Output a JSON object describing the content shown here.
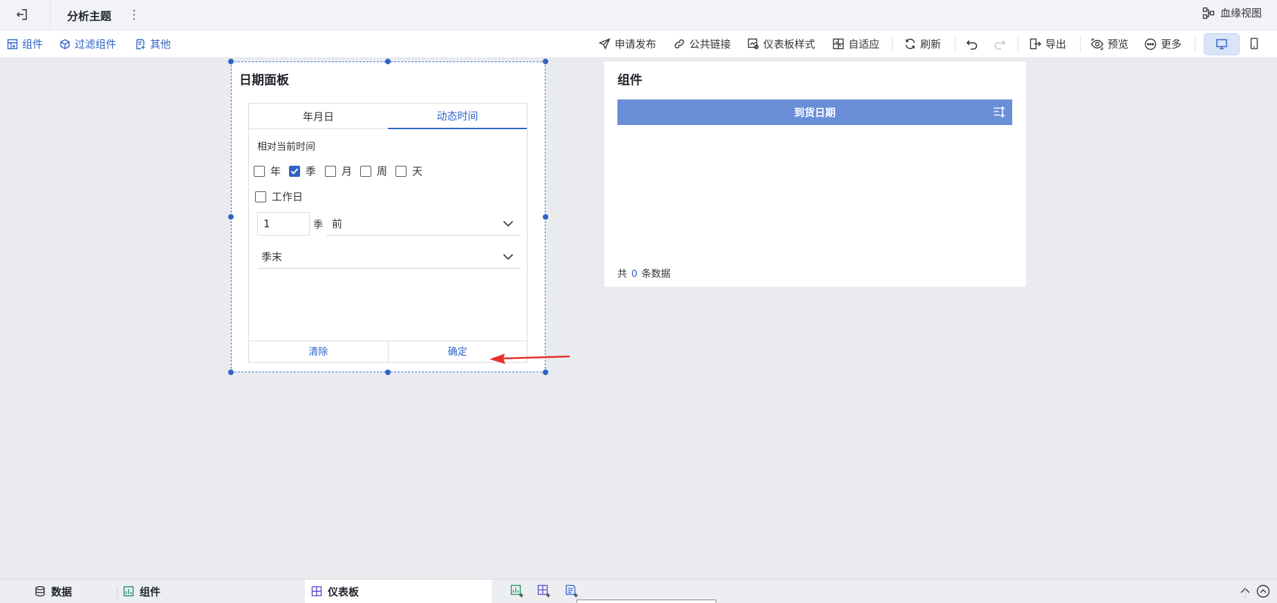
{
  "header": {
    "title": "分析主题",
    "lineage_label": "血缘视图"
  },
  "toolbar": {
    "left": [
      {
        "label": "组件",
        "icon": "add-component-icon"
      },
      {
        "label": "过滤组件",
        "icon": "filter-component-icon"
      },
      {
        "label": "其他",
        "icon": "other-icon"
      }
    ],
    "right": {
      "publish": "申请发布",
      "public_link": "公共链接",
      "dashboard_style": "仪表板样式",
      "adaptive": "自适应",
      "refresh": "刷新",
      "export": "导出",
      "preview": "预览",
      "more": "更多"
    }
  },
  "date_panel": {
    "title": "日期面板",
    "tabs": [
      "年月日",
      "动态时间"
    ],
    "active_tab": "动态时间",
    "relative_label": "相对当前时间",
    "units": [
      {
        "label": "年",
        "checked": false
      },
      {
        "label": "季",
        "checked": true
      },
      {
        "label": "月",
        "checked": false
      },
      {
        "label": "周",
        "checked": false
      },
      {
        "label": "天",
        "checked": false
      }
    ],
    "workday": {
      "label": "工作日",
      "checked": false
    },
    "offset_value": "1",
    "offset_unit": "季",
    "direction": "前",
    "period_point": "季末",
    "clear_label": "清除",
    "confirm_label": "确定"
  },
  "component_widget": {
    "title": "组件",
    "column_header": "到货日期",
    "footer_prefix": "共",
    "footer_count": "0",
    "footer_suffix": "条数据"
  },
  "bottom_bar": {
    "data_tab": "数据",
    "component_tab": "组件",
    "dashboard_tab": "仪表板"
  },
  "colors": {
    "accent": "#2f62c7",
    "table_header": "#6a8fd8",
    "canvas_bg": "#e9ebef",
    "annotation_arrow": "#e8302a"
  }
}
